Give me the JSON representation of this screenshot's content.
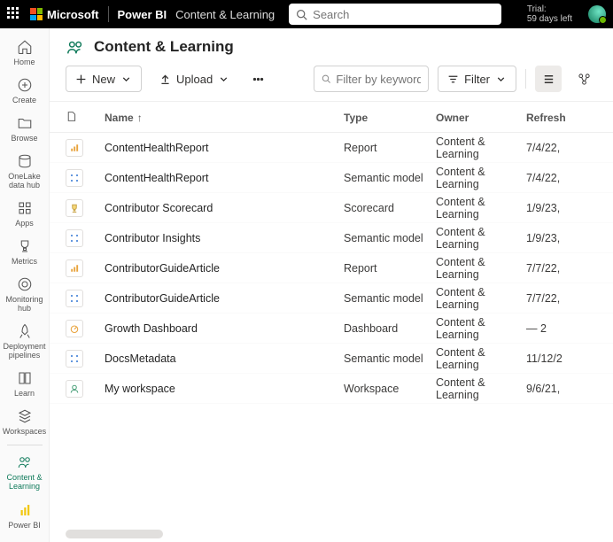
{
  "topbar": {
    "microsoft": "Microsoft",
    "product": "Power BI",
    "workspace": "Content & Learning",
    "search_placeholder": "Search",
    "trial_line1": "Trial:",
    "trial_line2": "59 days left"
  },
  "leftnav": {
    "items": [
      {
        "label": "Home"
      },
      {
        "label": "Create"
      },
      {
        "label": "Browse"
      },
      {
        "label": "OneLake data hub"
      },
      {
        "label": "Apps"
      },
      {
        "label": "Metrics"
      },
      {
        "label": "Monitoring hub"
      },
      {
        "label": "Deployment pipelines"
      },
      {
        "label": "Learn"
      },
      {
        "label": "Workspaces"
      },
      {
        "label": "Content & Learning"
      }
    ],
    "bottom": {
      "label": "Power BI"
    }
  },
  "header": {
    "title": "Content & Learning"
  },
  "toolbar": {
    "new": "New",
    "upload": "Upload",
    "filter_placeholder": "Filter by keyword",
    "filter": "Filter"
  },
  "columns": {
    "name": "Name",
    "type": "Type",
    "owner": "Owner",
    "refresh": "Refresh"
  },
  "rows": [
    {
      "icon": "report",
      "name": "ContentHealthReport",
      "type": "Report",
      "owner": "Content & Learning",
      "refresh": "7/4/22,"
    },
    {
      "icon": "model",
      "name": "ContentHealthReport",
      "type": "Semantic model",
      "owner": "Content & Learning",
      "refresh": "7/4/22,"
    },
    {
      "icon": "scorecard",
      "name": "Contributor Scorecard",
      "type": "Scorecard",
      "owner": "Content & Learning",
      "refresh": "1/9/23,"
    },
    {
      "icon": "model",
      "name": "Contributor Insights",
      "type": "Semantic model",
      "owner": "Content & Learning",
      "refresh": "1/9/23,"
    },
    {
      "icon": "report",
      "name": "ContributorGuideArticle",
      "type": "Report",
      "owner": "Content & Learning",
      "refresh": "7/7/22,"
    },
    {
      "icon": "model",
      "name": "ContributorGuideArticle",
      "type": "Semantic model",
      "owner": "Content & Learning",
      "refresh": "7/7/22,"
    },
    {
      "icon": "dashboard",
      "name": "Growth Dashboard",
      "type": "Dashboard",
      "owner": "Content & Learning",
      "refresh": "—        2"
    },
    {
      "icon": "model",
      "name": "DocsMetadata",
      "type": "Semantic model",
      "owner": "Content & Learning",
      "refresh": "11/12/2"
    },
    {
      "icon": "workspace",
      "name": "My workspace",
      "type": "Workspace",
      "owner": "Content & Learning",
      "refresh": "9/6/21,"
    }
  ]
}
